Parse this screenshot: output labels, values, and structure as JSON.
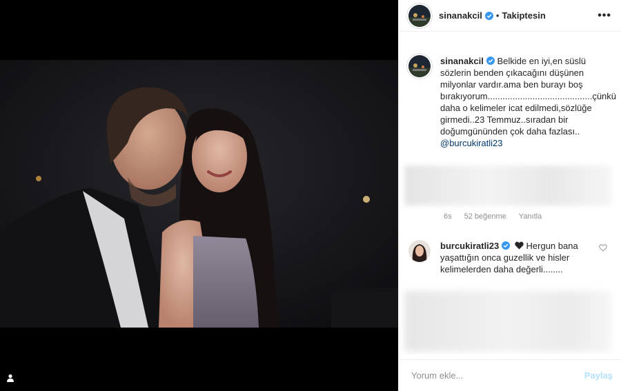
{
  "post": {
    "username": "sinanakcil",
    "follow_status": "Takiptesin",
    "dot": "•",
    "more_label": "•••"
  },
  "caption": {
    "username": "sinanakcil",
    "text": "Belkide en iyi,en süslü sözlerin benden çıkacağını düşünen milyonlar vardır.ama ben burayı boş bırakıyorum..........................................çünkü daha o kelimeler icat edilmedi,sözlüğe girmedi..23 Temmuz..sıradan bir doğumgününden çok daha fazlası.. ",
    "mention": "@burcukiratli23"
  },
  "comment_meta": {
    "time": "6s",
    "likes": "52 beğenme",
    "reply": "Yanıtla"
  },
  "reply": {
    "username": "burcukiratli23",
    "text": " Hergun bana yaşattığın onca guzellik ve hisler kelimelerden daha değerli........"
  },
  "footer": {
    "placeholder": "Yorum ekle...",
    "post_label": "Paylaş"
  },
  "colors": {
    "verified": "#3897f0",
    "link": "#00376b",
    "muted": "#8e8e8e"
  },
  "icons": [
    "user-tag-icon",
    "verified-icon",
    "black-heart-icon",
    "heart-outline-icon",
    "more-options-icon"
  ]
}
